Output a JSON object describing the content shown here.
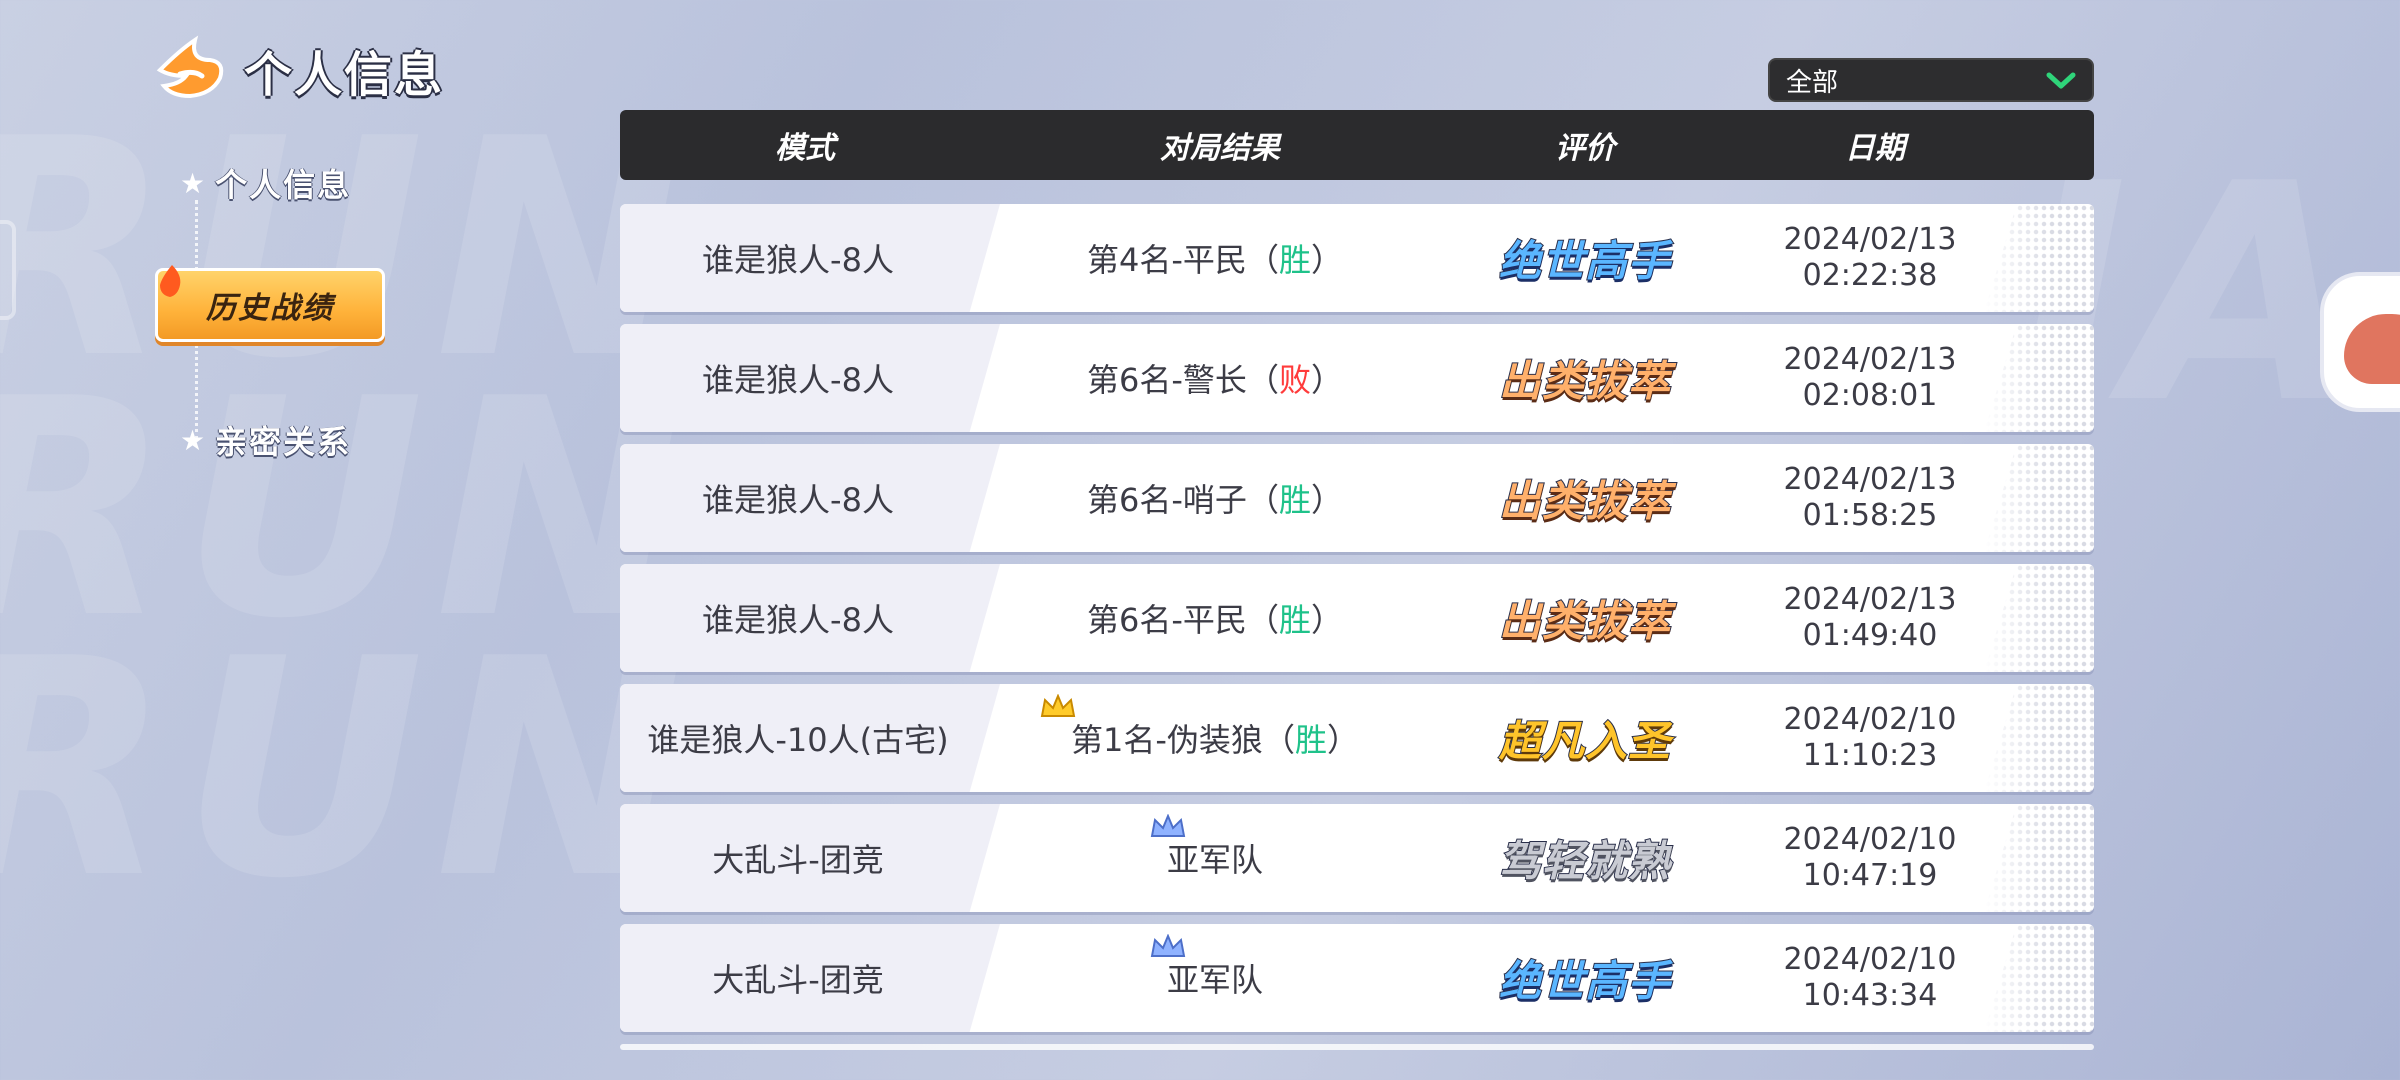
{
  "header": {
    "title": "个人信息"
  },
  "sidebar": {
    "items": [
      {
        "label": "个人信息"
      },
      {
        "label": "历史战绩"
      },
      {
        "label": "亲密关系"
      }
    ]
  },
  "filter": {
    "value": "全部"
  },
  "table": {
    "headers": {
      "mode": "模式",
      "result": "对局结果",
      "rating": "评价",
      "date": "日期"
    },
    "rows": [
      {
        "mode": "谁是狼人-8人",
        "result": "第4名-平民",
        "open": "（",
        "outcome": "胜",
        "close": "）",
        "rating": "绝世高手",
        "date": "2024/02/13",
        "time": "02:22:38"
      },
      {
        "mode": "谁是狼人-8人",
        "result": "第6名-警长",
        "open": "（",
        "outcome": "败",
        "close": "）",
        "rating": "出类拔萃",
        "date": "2024/02/13",
        "time": "02:08:01"
      },
      {
        "mode": "谁是狼人-8人",
        "result": "第6名-哨子",
        "open": "（",
        "outcome": "胜",
        "close": "）",
        "rating": "出类拔萃",
        "date": "2024/02/13",
        "time": "01:58:25"
      },
      {
        "mode": "谁是狼人-8人",
        "result": "第6名-平民",
        "open": "（",
        "outcome": "胜",
        "close": "）",
        "rating": "出类拔萃",
        "date": "2024/02/13",
        "time": "01:49:40"
      },
      {
        "mode": "谁是狼人-10人(古宅)",
        "result": "第1名-伪装狼",
        "open": "（",
        "outcome": "胜",
        "close": "）",
        "rating": "超凡入圣",
        "date": "2024/02/10",
        "time": "11:10:23"
      },
      {
        "mode": "大乱斗-团竞",
        "result": "亚军队",
        "rating": "驾轻就熟",
        "date": "2024/02/10",
        "time": "10:47:19"
      },
      {
        "mode": "大乱斗-团竞",
        "result": "亚军队",
        "rating": "绝世高手",
        "date": "2024/02/10",
        "time": "10:43:34"
      }
    ]
  },
  "colors": {
    "win": "#1fc28a",
    "lose": "#ff3b3b",
    "active_tab": "#ffb23a",
    "header_bg": "#2b2b2d"
  },
  "icons": [
    "flame-logo-icon",
    "star-icon",
    "chevron-down-icon",
    "gold-crown-icon",
    "blue-crown-icon"
  ]
}
